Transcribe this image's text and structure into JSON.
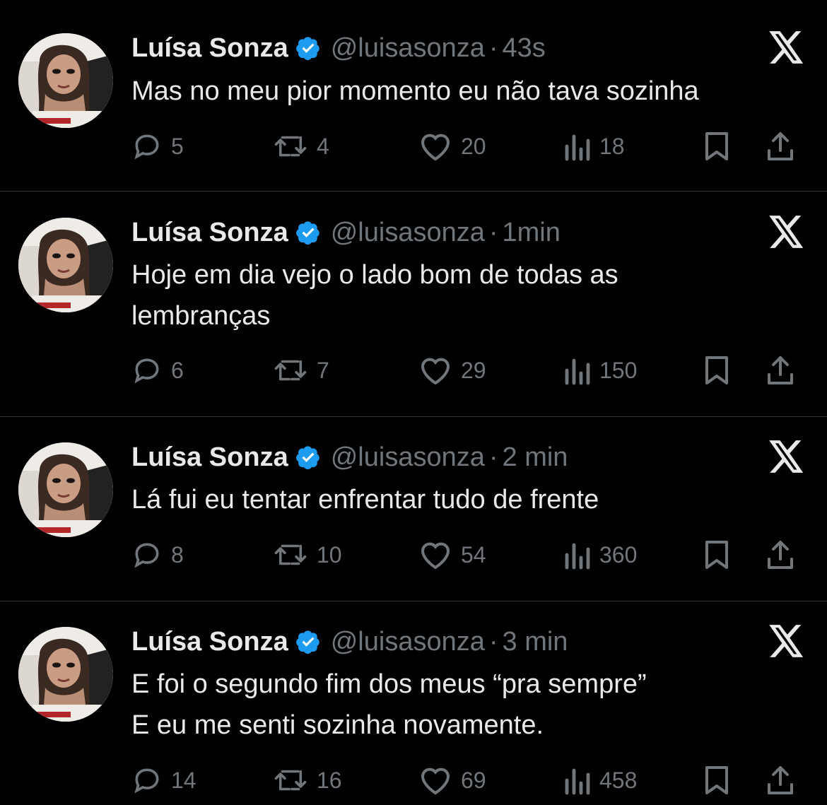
{
  "accent_verified": "#1d9bf0",
  "tweets": [
    {
      "name": "Luísa Sonza",
      "handle": "@luisasonza",
      "separator": "·",
      "time": "43s",
      "lines": [
        "Mas no meu pior momento eu não tava sozinha"
      ],
      "replies": "5",
      "retweets": "4",
      "likes": "20",
      "views": "18"
    },
    {
      "name": "Luísa Sonza",
      "handle": "@luisasonza",
      "separator": "·",
      "time": "1min",
      "lines": [
        "Hoje em dia vejo o lado bom de todas as",
        "lembranças"
      ],
      "replies": "6",
      "retweets": "7",
      "likes": "29",
      "views": "150"
    },
    {
      "name": "Luísa Sonza",
      "handle": "@luisasonza",
      "separator": "·",
      "time": "2 min",
      "lines": [
        "Lá fui eu tentar enfrentar tudo de frente"
      ],
      "replies": "8",
      "retweets": "10",
      "likes": "54",
      "views": "360"
    },
    {
      "name": "Luísa Sonza",
      "handle": "@luisasonza",
      "separator": "·",
      "time": "3 min",
      "lines": [
        "E foi o segundo fim dos meus “pra sempre”",
        "E eu me senti sozinha novamente."
      ],
      "replies": "14",
      "retweets": "16",
      "likes": "69",
      "views": "458"
    }
  ],
  "icons": {
    "verified": "verified-badge-icon",
    "x_logo": "x-logo-icon",
    "reply": "reply-icon",
    "retweet": "retweet-icon",
    "like": "heart-icon",
    "views": "views-icon",
    "bookmark": "bookmark-icon",
    "share": "share-icon"
  }
}
